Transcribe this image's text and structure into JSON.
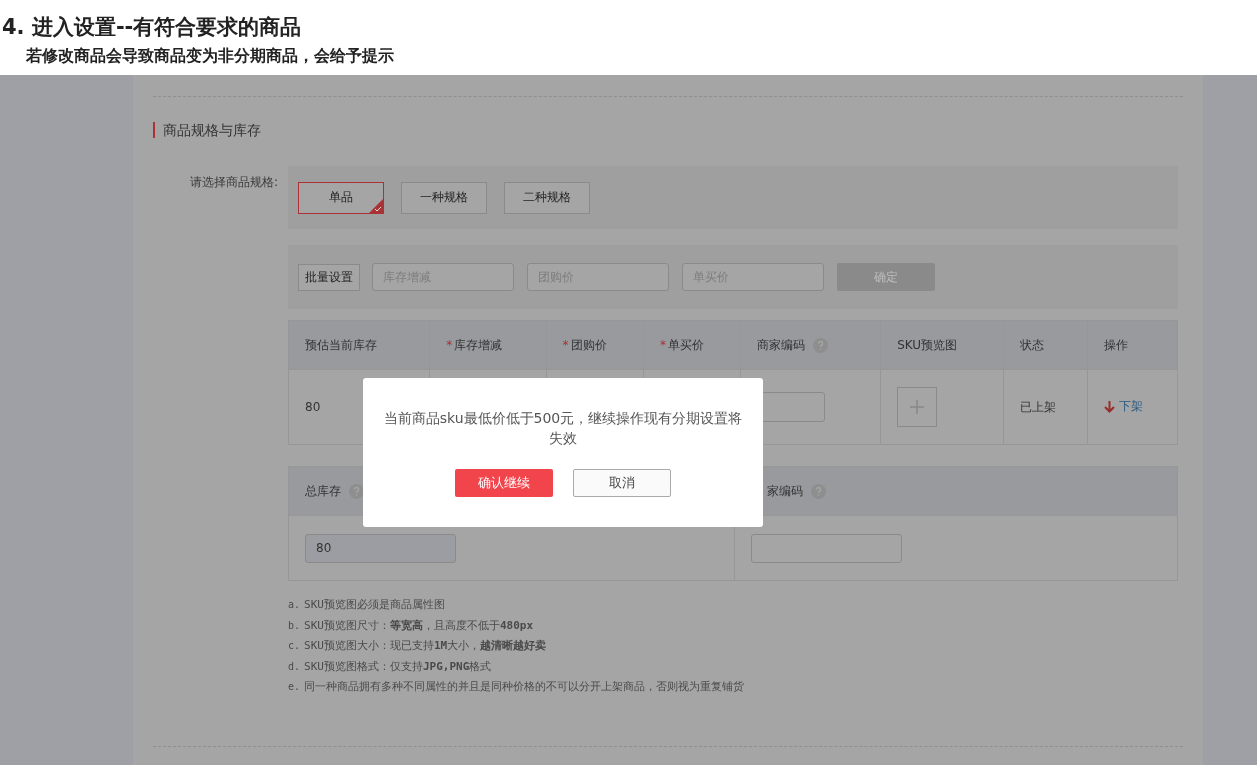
{
  "heading": {
    "title": "4. 进入设置--有符合要求的商品",
    "subtitle": "若修改商品会导致商品变为非分期商品，会给予提示"
  },
  "section_title": "商品规格与库存",
  "spec": {
    "label": "请选择商品规格:",
    "options": [
      {
        "label": "单品",
        "selected": true
      },
      {
        "label": "一种规格",
        "selected": false
      },
      {
        "label": "二种规格",
        "selected": false
      }
    ]
  },
  "batch": {
    "label": "批量设置",
    "fields": [
      {
        "placeholder": "库存增减"
      },
      {
        "placeholder": "团购价"
      },
      {
        "placeholder": "单买价"
      }
    ],
    "confirm": "确定"
  },
  "sku_table": {
    "columns": [
      {
        "label": "预估当前库存"
      },
      {
        "label": "库存增减",
        "marker": "*"
      },
      {
        "label": "团购价",
        "marker": "*"
      },
      {
        "label": "单买价",
        "marker": "*"
      },
      {
        "label": "商家编码",
        "help": true
      },
      {
        "label": "SKU预览图"
      },
      {
        "label": "状态"
      },
      {
        "label": "操作"
      }
    ],
    "rows": [
      {
        "stock": "80",
        "status": "已上架",
        "action": "下架"
      }
    ]
  },
  "totals": {
    "columns": [
      {
        "label": "总库存",
        "help": true
      },
      {
        "label": "家编码",
        "help": true
      }
    ],
    "stock_value": "80"
  },
  "notes": [
    {
      "marker": "a.",
      "text": "SKU预览图必须是商品属性图"
    },
    {
      "marker": "b.",
      "text": "SKU预览图尺寸：**等宽高**，且高度不低于**480px**"
    },
    {
      "marker": "c.",
      "text": "SKU预览图大小：现已支持**1M**大小，**越清晰越好卖**"
    },
    {
      "marker": "d.",
      "text": "SKU预览图格式：仅支持**JPG,PNG**格式"
    },
    {
      "marker": "e.",
      "text": "同一种商品拥有多种不同属性的并且是同种价格的不可以分开上架商品，否则视为重复铺货"
    }
  ],
  "dialog": {
    "message": "当前商品sku最低价低于500元，继续操作现有分期设置将失效",
    "confirm": "确认继续",
    "cancel": "取消"
  }
}
